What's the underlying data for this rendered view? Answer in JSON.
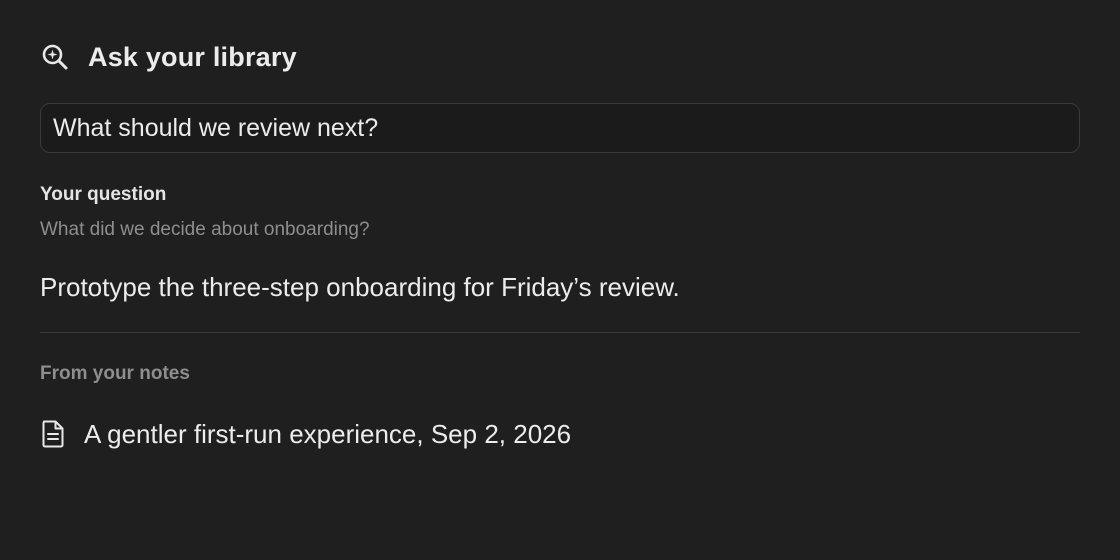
{
  "header": {
    "title": "Ask your library",
    "icon": "search-sparkle-icon"
  },
  "query": {
    "value": "What should we review next?"
  },
  "question": {
    "label": "Your question",
    "text": "What did we decide about onboarding?"
  },
  "answer": {
    "text": "Prototype the three-step onboarding for Friday’s review."
  },
  "sources": {
    "label": "From your notes",
    "items": [
      {
        "icon": "document-icon",
        "label": "A gentler first-run experience, Sep 2, 2026"
      }
    ]
  },
  "colors": {
    "background": "#1f1f1f",
    "text": "#ececec",
    "muted": "#8e8e8e",
    "border": "#3a3a3a"
  }
}
